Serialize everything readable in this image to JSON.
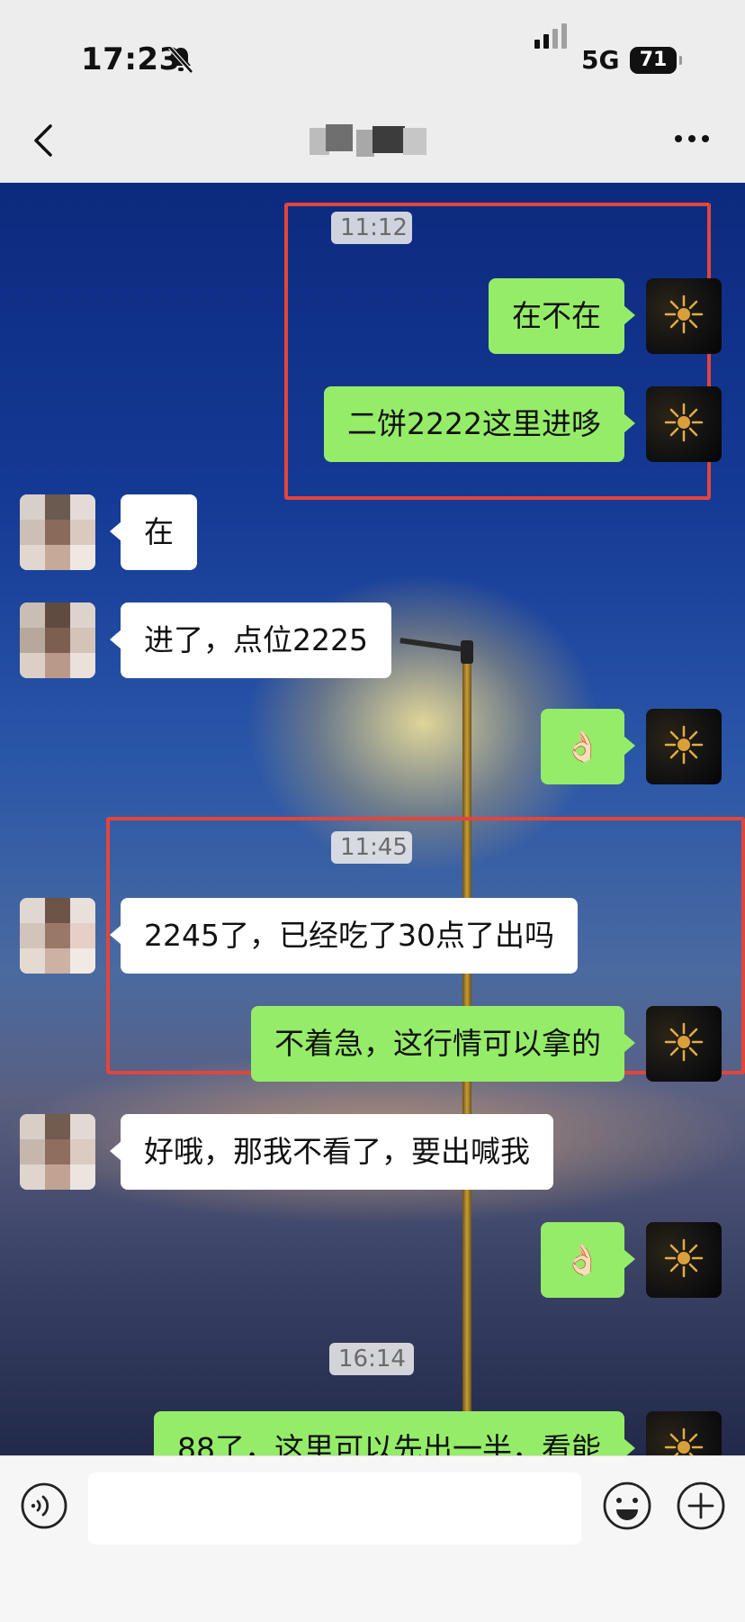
{
  "status_bar": {
    "time": "17:23",
    "network": "5G",
    "battery": "71",
    "icons": [
      "bell-slash-icon",
      "signal-bars-icon",
      "battery-icon"
    ]
  },
  "nav": {
    "back_icon": "chevron-left-icon",
    "contact_name": "",
    "more_icon": "more-dots-icon"
  },
  "chat": {
    "timestamps": [
      "11:12",
      "11:45",
      "16:14"
    ],
    "messages": [
      {
        "from": "me",
        "text": "在不在"
      },
      {
        "from": "me",
        "text": "二饼2222这里进哆"
      },
      {
        "from": "them",
        "text": "在"
      },
      {
        "from": "them",
        "text": "进了，点位2225"
      },
      {
        "from": "me",
        "text": "👌🏻"
      },
      {
        "from": "them",
        "text": "2245了，已经吃了30点了出吗"
      },
      {
        "from": "me",
        "text": "不着急，这行情可以拿的"
      },
      {
        "from": "them",
        "text": "好哦，那我不看了，要出喊我"
      },
      {
        "from": "me",
        "text": "👌🏻"
      },
      {
        "from": "me",
        "text": "88了，这里可以先出一半，看能"
      }
    ]
  },
  "input_bar": {
    "text_value": "",
    "icons": [
      "voice-icon",
      "emoji-icon",
      "plus-icon"
    ]
  },
  "colors": {
    "my_bubble": "#95ec69",
    "their_bubble": "#ffffff",
    "highlight_box": "#e2453c"
  }
}
